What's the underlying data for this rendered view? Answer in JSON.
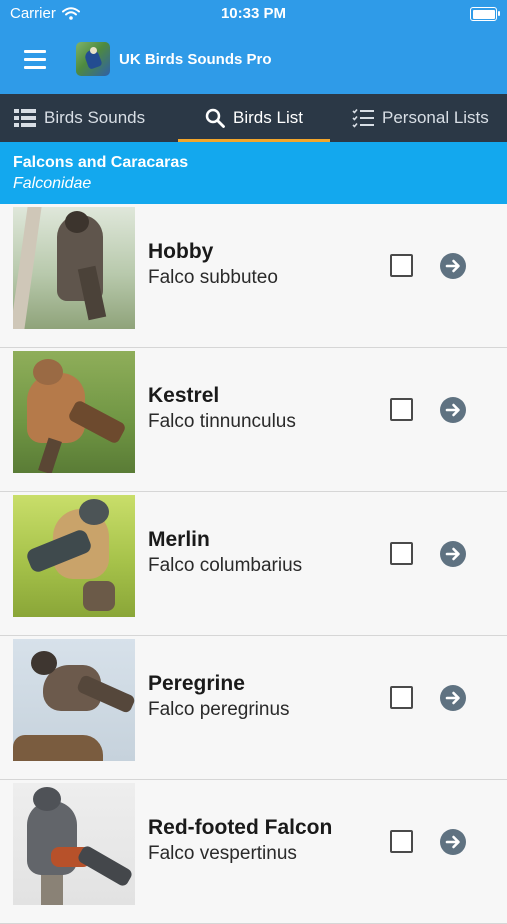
{
  "status_bar": {
    "carrier": "Carrier",
    "time": "10:33 PM"
  },
  "app_bar": {
    "title": "UK Birds Sounds Pro"
  },
  "tabs": [
    {
      "label": "Birds Sounds",
      "icon": "list-icon",
      "active": false
    },
    {
      "label": "Birds List",
      "icon": "search-icon",
      "active": true
    },
    {
      "label": "Personal Lists",
      "icon": "checklist-icon",
      "active": false
    }
  ],
  "section": {
    "name": "Falcons and Caracaras",
    "latin": "Falconidae"
  },
  "birds": [
    {
      "common": "Hobby",
      "scientific": "Falco subbuteo",
      "checked": false
    },
    {
      "common": "Kestrel",
      "scientific": "Falco tinnunculus",
      "checked": false
    },
    {
      "common": "Merlin",
      "scientific": "Falco columbarius",
      "checked": false
    },
    {
      "common": "Peregrine",
      "scientific": "Falco peregrinus",
      "checked": false
    },
    {
      "common": "Red-footed Falcon",
      "scientific": "Falco vespertinus",
      "checked": false
    }
  ],
  "colors": {
    "primary": "#2f9be8",
    "tab_bar": "#2b3846",
    "tab_indicator": "#f3a62c",
    "section_header": "#13a8ee",
    "arrow_button": "#5f7281"
  }
}
